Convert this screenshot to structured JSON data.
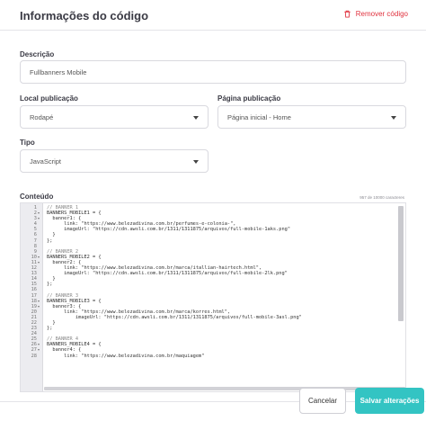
{
  "header": {
    "title": "Informações do código",
    "remove_label": "Remover código",
    "accent_color": "#e0323e"
  },
  "form": {
    "description": {
      "label": "Descrição",
      "value": "Fullbanners Mobile"
    },
    "local": {
      "label": "Local publicação",
      "value": "Rodapé"
    },
    "page": {
      "label": "Página publicação",
      "value": "Página inicial - Home"
    },
    "type": {
      "label": "Tipo",
      "value": "JavaScript"
    },
    "content": {
      "label": "Conteúdo",
      "counter": "957 de 10000 caracteres"
    }
  },
  "editor": {
    "lines": [
      {
        "n": "1",
        "fold": false,
        "text": "// BANNER 1",
        "comment": true
      },
      {
        "n": "2",
        "fold": true,
        "text": "BANNERS_MOBILE1 = {"
      },
      {
        "n": "3",
        "fold": true,
        "text": "  banner1: {"
      },
      {
        "n": "4",
        "fold": false,
        "text": "      link: \"https://www.belezadivina.com.br/perfumes-e-colonia-\","
      },
      {
        "n": "5",
        "fold": false,
        "text": "      imageUrl: \"https://cdn.awsli.com.br/1311/1311875/arquivos/full-mobile-1aks.png\""
      },
      {
        "n": "6",
        "fold": false,
        "text": "  }"
      },
      {
        "n": "7",
        "fold": false,
        "text": "};"
      },
      {
        "n": "8",
        "fold": false,
        "text": ""
      },
      {
        "n": "9",
        "fold": false,
        "text": "// BANNER 2",
        "comment": true
      },
      {
        "n": "10",
        "fold": true,
        "text": "BANNERS_MOBILE2 = {"
      },
      {
        "n": "11",
        "fold": true,
        "text": "  banner2: {"
      },
      {
        "n": "12",
        "fold": false,
        "text": "      link: \"https://www.belezadivina.com.br/marca/itallian-hairtech.html\","
      },
      {
        "n": "13",
        "fold": false,
        "text": "      imageUrl: \"https://cdn.awsli.com.br/1311/1311875/arquivos/full-mobile-2lk.png\""
      },
      {
        "n": "14",
        "fold": false,
        "text": "  }"
      },
      {
        "n": "15",
        "fold": false,
        "text": "};"
      },
      {
        "n": "16",
        "fold": false,
        "text": ""
      },
      {
        "n": "17",
        "fold": false,
        "text": "// BANNER 3",
        "comment": true
      },
      {
        "n": "18",
        "fold": true,
        "text": "BANNERS_MOBILE3 = {"
      },
      {
        "n": "19",
        "fold": true,
        "text": "  banner3: {"
      },
      {
        "n": "20",
        "fold": false,
        "text": "      link: \"https://www.belezadivina.com.br/marca/korres.html\","
      },
      {
        "n": "21",
        "fold": false,
        "text": "          imageUrl: \"https://cdn.awsli.com.br/1311/1311875/arquivos/full-mobile-3asl.png\""
      },
      {
        "n": "22",
        "fold": false,
        "text": "  }"
      },
      {
        "n": "23",
        "fold": false,
        "text": "};"
      },
      {
        "n": "24",
        "fold": false,
        "text": ""
      },
      {
        "n": "25",
        "fold": false,
        "text": "// BANNER 4",
        "comment": true
      },
      {
        "n": "26",
        "fold": true,
        "text": "BANNERS_MOBILE4 = {"
      },
      {
        "n": "27",
        "fold": true,
        "text": "  banner4: {"
      },
      {
        "n": "28",
        "fold": false,
        "text": "      link: \"https://www.belezadivina.com.br/maquiagem\""
      }
    ]
  },
  "footer": {
    "cancel_label": "Cancelar",
    "save_label": "Salvar alterações",
    "save_color": "#33c4c3"
  },
  "icons": {
    "remove": "trash-icon",
    "select": "chevron-down-icon"
  }
}
